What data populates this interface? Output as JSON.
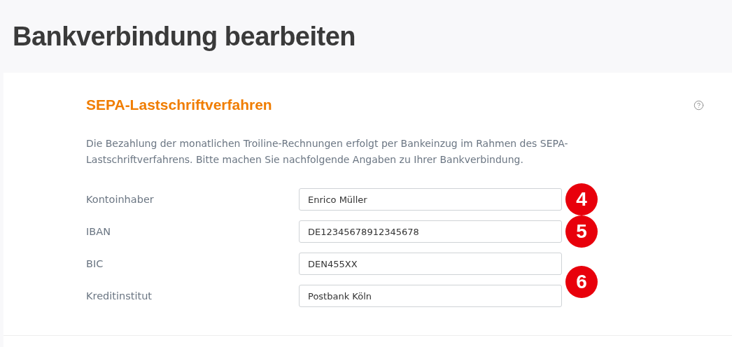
{
  "page_title": "Bankverbindung bearbeiten",
  "section": {
    "title": "SEPA-Lastschriftverfahren",
    "description": "Die Bezahlung der monatlichen Troiline-Rechnungen erfolgt per Bankeinzug im Rahmen des SEPA-Lastschriftverfahrens. Bitte machen Sie nachfolgende Angaben zu Ihrer Bankverbindung.",
    "fields": [
      {
        "label": "Kontoinhaber",
        "value": "Enrico Müller",
        "badge": "4",
        "kind": "badge"
      },
      {
        "label": "IBAN",
        "value": "DE12345678912345678",
        "badge": "5",
        "kind": "badge"
      },
      {
        "label": "BIC",
        "value": "DEN455XX",
        "badge": "6",
        "kind": "spanbadge"
      },
      {
        "label": "Kreditinstitut",
        "value": "Postbank Köln",
        "kind": "plain"
      }
    ]
  }
}
